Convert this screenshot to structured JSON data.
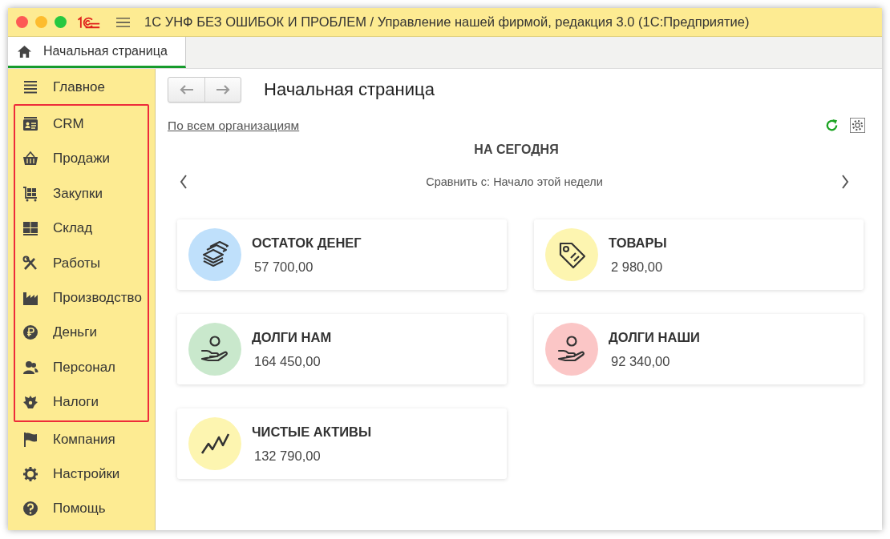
{
  "window": {
    "title": "1С УНФ БЕЗ ОШИБОК И ПРОБЛЕМ / Управление нашей фирмой, редакция 3.0  (1С:Предприятие)"
  },
  "tabs": [
    {
      "label": "Начальная страница",
      "selected": true
    }
  ],
  "sidebar": {
    "sections": [
      {
        "framed": false,
        "items": [
          {
            "label": "Главное",
            "kind": "menu"
          }
        ]
      },
      {
        "framed": true,
        "items": [
          {
            "label": "CRM",
            "kind": "crm"
          },
          {
            "label": "Продажи",
            "kind": "basket"
          },
          {
            "label": "Закупки",
            "kind": "cart"
          },
          {
            "label": "Склад",
            "kind": "blocks"
          },
          {
            "label": "Работы",
            "kind": "tools"
          },
          {
            "label": "Производство",
            "kind": "factory"
          },
          {
            "label": "Деньги",
            "kind": "ruble"
          },
          {
            "label": "Персонал",
            "kind": "people"
          },
          {
            "label": "Налоги",
            "kind": "emblem"
          }
        ]
      },
      {
        "framed": false,
        "items": [
          {
            "label": "Компания",
            "kind": "flag"
          },
          {
            "label": "Настройки",
            "kind": "gear"
          },
          {
            "label": "Помощь",
            "kind": "help"
          }
        ]
      }
    ]
  },
  "page": {
    "title": "Начальная страница",
    "org_link": "По всем организациям",
    "heading": "НА СЕГОДНЯ",
    "compare": "Сравнить с: Начало этой недели"
  },
  "cards": [
    {
      "title": "ОСТАТОК ДЕНЕГ",
      "value": "57 700,00",
      "color": "#bfe0fb",
      "kind": "money"
    },
    {
      "title": "ТОВАРЫ",
      "value": "2 980,00",
      "color": "#fdf5b0",
      "kind": "tag"
    },
    {
      "title": "ДОЛГИ НАМ",
      "value": "164 450,00",
      "color": "#c9e8cc",
      "kind": "hand"
    },
    {
      "title": "ДОЛГИ НАШИ",
      "value": "92 340,00",
      "color": "#fbc6c6",
      "kind": "hand"
    },
    {
      "title": "ЧИСТЫЕ АКТИВЫ",
      "value": "132 790,00",
      "color": "#fdf5b0",
      "kind": "chart"
    }
  ]
}
